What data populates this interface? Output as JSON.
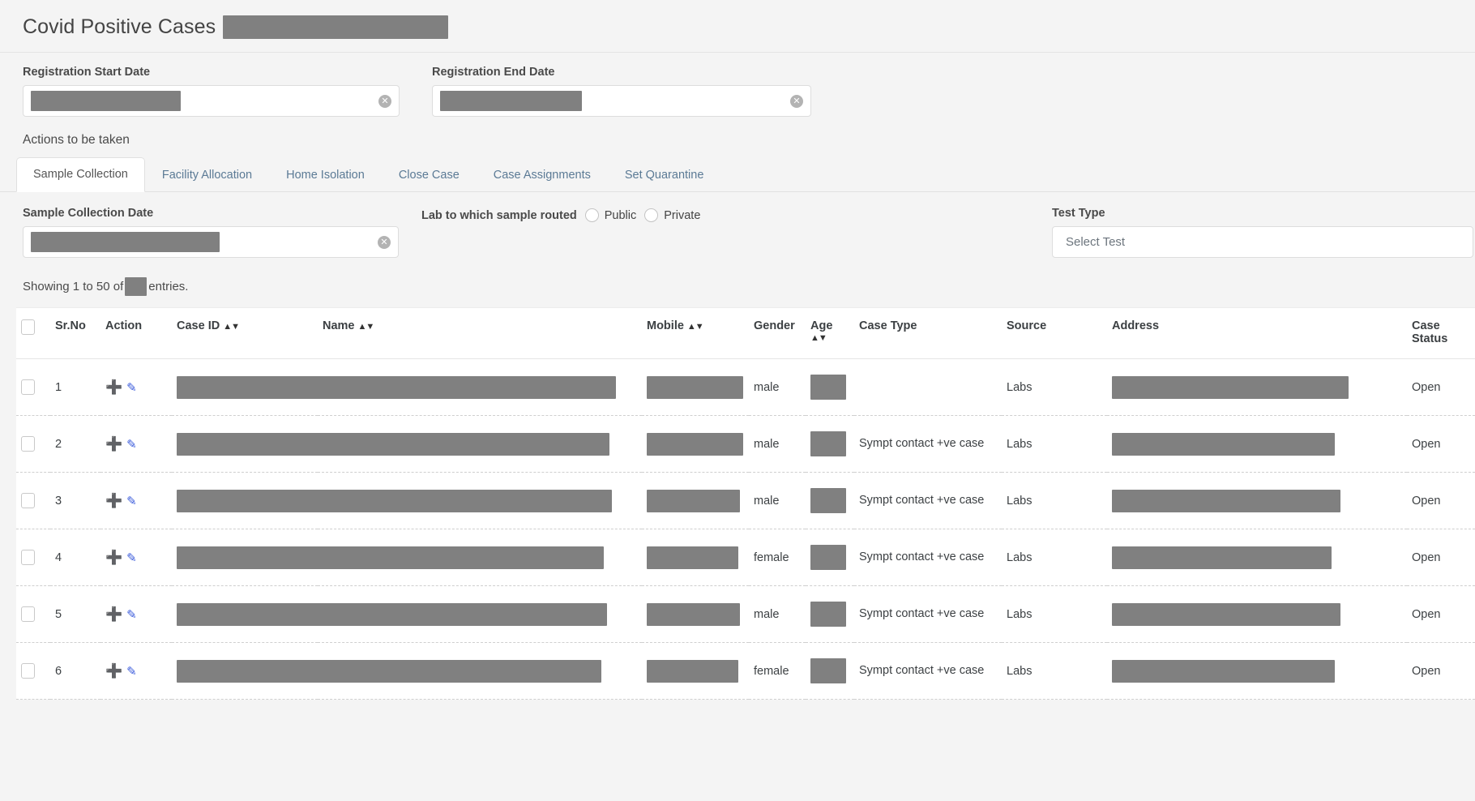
{
  "header": {
    "title": "Covid Positive Cases",
    "title_redacted_width": 278
  },
  "filters": {
    "start_date": {
      "label": "Registration Start Date",
      "value": "",
      "redacted_width": 185,
      "clear_icon": "clear-circle-icon",
      "clear_glyph": "✕"
    },
    "end_date": {
      "label": "Registration End Date",
      "value": "",
      "redacted_width": 175,
      "clear_icon": "clear-circle-icon",
      "clear_glyph": "✕"
    }
  },
  "actions": {
    "label": "Actions to be taken",
    "tabs": [
      {
        "label": "Sample Collection",
        "active": true
      },
      {
        "label": "Facility Allocation",
        "active": false
      },
      {
        "label": "Home Isolation",
        "active": false
      },
      {
        "label": "Close Case",
        "active": false
      },
      {
        "label": "Case Assignments",
        "active": false
      },
      {
        "label": "Set Quarantine",
        "active": false
      }
    ]
  },
  "sample_collection": {
    "date_label": "Sample Collection Date",
    "date_value": "",
    "date_redacted_width": 233,
    "lab_label": "Lab to which sample routed",
    "lab_options": [
      {
        "label": "Public",
        "selected": false
      },
      {
        "label": "Private",
        "selected": false
      }
    ],
    "test_type_label": "Test Type",
    "test_type_value": "Select Test"
  },
  "table_info": {
    "showing_prefix": "Showing 1 to 50 of",
    "showing_suffix": "entries.",
    "total_redacted": true
  },
  "table": {
    "columns": [
      {
        "key": "checkbox",
        "label": "",
        "sortable": false
      },
      {
        "key": "srno",
        "label": "Sr.No",
        "sortable": false
      },
      {
        "key": "action",
        "label": "Action",
        "sortable": false
      },
      {
        "key": "caseid",
        "label": "Case ID",
        "sortable": true
      },
      {
        "key": "name",
        "label": "Name",
        "sortable": true
      },
      {
        "key": "mobile",
        "label": "Mobile",
        "sortable": true
      },
      {
        "key": "gender",
        "label": "Gender",
        "sortable": false
      },
      {
        "key": "age",
        "label": "Age",
        "sortable": true
      },
      {
        "key": "casetype",
        "label": "Case Type",
        "sortable": false
      },
      {
        "key": "source",
        "label": "Source",
        "sortable": false
      },
      {
        "key": "address",
        "label": "Address",
        "sortable": false
      },
      {
        "key": "status",
        "label": "Case Status",
        "sortable": false
      }
    ],
    "sort_glyph": "⬍",
    "action_icons": {
      "add": "plus-icon",
      "add_glyph": "＋",
      "edit": "edit-icon",
      "edit_glyph": "✎"
    },
    "rows": [
      {
        "srno": "1",
        "caseid": "",
        "caseid_w": 272,
        "name": "",
        "name_w": 270,
        "mobile": "",
        "mobile_w": 119,
        "gender": "male",
        "age": "",
        "casetype": "",
        "source": "Labs",
        "address": "",
        "address_w": 292,
        "status": "Open"
      },
      {
        "srno": "2",
        "caseid": "",
        "caseid_w": 272,
        "name": "",
        "name_w": 262,
        "mobile": "",
        "mobile_w": 119,
        "gender": "male",
        "age": "",
        "casetype": "Sympt contact +ve case",
        "source": "Labs",
        "address": "",
        "address_w": 275,
        "status": "Open"
      },
      {
        "srno": "3",
        "caseid": "",
        "caseid_w": 272,
        "name": "",
        "name_w": 265,
        "mobile": "",
        "mobile_w": 115,
        "gender": "male",
        "age": "",
        "casetype": "Sympt contact +ve case",
        "source": "Labs",
        "address": "",
        "address_w": 282,
        "status": "Open"
      },
      {
        "srno": "4",
        "caseid": "",
        "caseid_w": 272,
        "name": "",
        "name_w": 255,
        "mobile": "",
        "mobile_w": 113,
        "gender": "female",
        "age": "",
        "casetype": "Sympt contact +ve case",
        "source": "Labs",
        "address": "",
        "address_w": 271,
        "status": "Open"
      },
      {
        "srno": "5",
        "caseid": "",
        "caseid_w": 272,
        "name": "",
        "name_w": 259,
        "mobile": "",
        "mobile_w": 115,
        "gender": "male",
        "age": "",
        "casetype": "Sympt contact +ve case",
        "source": "Labs",
        "address": "",
        "address_w": 282,
        "status": "Open"
      },
      {
        "srno": "6",
        "caseid": "",
        "caseid_w": 272,
        "name": "",
        "name_w": 252,
        "mobile": "",
        "mobile_w": 113,
        "gender": "female",
        "age": "",
        "casetype": "Sympt contact +ve case",
        "source": "Labs",
        "address": "",
        "address_w": 275,
        "status": "Open"
      }
    ]
  },
  "colors": {
    "page_background": "#f4f4f4",
    "redaction": "#808080",
    "tab_inactive_text": "#5b7a95",
    "action_icon": "#3b5bdb",
    "table_background": "#ffffff"
  }
}
